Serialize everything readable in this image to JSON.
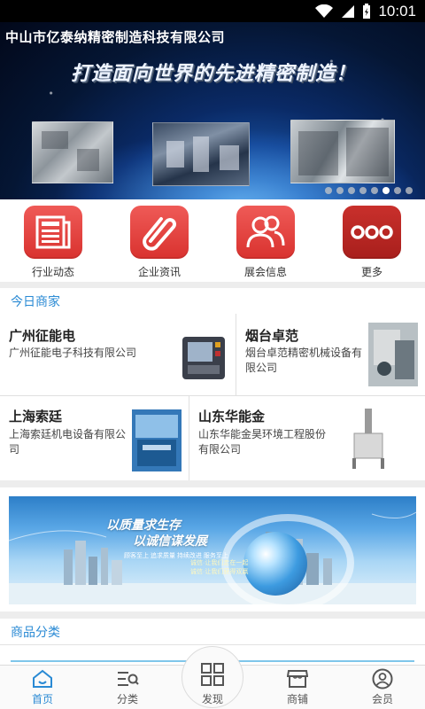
{
  "status_bar": {
    "time": "10:01"
  },
  "banner": {
    "company": "中山市亿泰纳精密制造科技有限公司",
    "slogan": "打造面向世界的先进精密制造！",
    "dot_count": 8,
    "active_dot": 5
  },
  "quick_nav": [
    {
      "label": "行业动态",
      "icon": "newspaper-icon"
    },
    {
      "label": "企业资讯",
      "icon": "paperclip-icon"
    },
    {
      "label": "展会信息",
      "icon": "people-icon"
    },
    {
      "label": "更多",
      "icon": "more-dots-icon"
    }
  ],
  "merchants": {
    "title": "今日商家",
    "items": [
      {
        "name": "广州征能电",
        "desc": "广州征能电子科技有限公司"
      },
      {
        "name": "烟台卓范",
        "desc": "烟台卓范精密机械设备有限公司"
      },
      {
        "name": "上海索廷",
        "desc": "上海索廷机电设备有限公司"
      },
      {
        "name": "山东华能金",
        "desc": "山东华能金昊环境工程股份有限公司"
      }
    ]
  },
  "promo": {
    "line1": "以质量求生存",
    "line2": "以诚信谋发展",
    "line3": "顾客至上 追求质量 持续改进 服务至上",
    "line4": "诚信·让我们走在一起",
    "line5": "诚信·让我们获得双赢"
  },
  "category": {
    "title": "商品分类"
  },
  "bottom_nav": [
    {
      "label": "首页",
      "icon": "home-icon",
      "active": true
    },
    {
      "label": "分类",
      "icon": "category-icon",
      "active": false
    },
    {
      "label": "发现",
      "icon": "grid-icon",
      "active": false
    },
    {
      "label": "商铺",
      "icon": "shop-icon",
      "active": false
    },
    {
      "label": "会员",
      "icon": "user-icon",
      "active": false
    }
  ],
  "colors": {
    "accent": "#2a8ad4",
    "icon_red": "#e04541",
    "icon_dark_red": "#b02521"
  }
}
